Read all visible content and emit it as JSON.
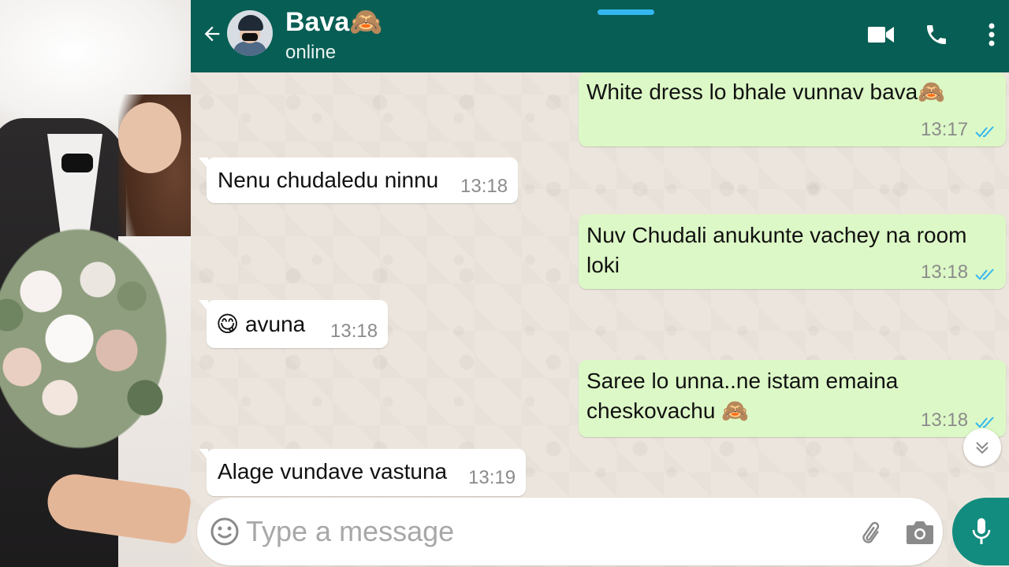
{
  "contact": {
    "name": "Bava🙈",
    "status": "online"
  },
  "messages": [
    {
      "direction": "out",
      "text": "White dress lo bhale vunnav bava🙈",
      "time": "13:17",
      "read": true
    },
    {
      "direction": "in",
      "text": "Nenu chudaledu ninnu",
      "time": "13:18"
    },
    {
      "direction": "out",
      "text": "Nuv Chudali anukunte vachey na room loki",
      "time": "13:18",
      "read": true
    },
    {
      "direction": "in",
      "text": "😋 avuna",
      "time": "13:18"
    },
    {
      "direction": "out",
      "text": "Saree lo unna..ne istam emaina cheskovachu 🙈",
      "time": "13:18",
      "read": true
    },
    {
      "direction": "in",
      "text": "Alage vundave vastuna",
      "time": "13:19"
    }
  ],
  "composer": {
    "placeholder": "Type a message"
  },
  "icons": {
    "back": "arrow-left-icon",
    "video": "video-camera-icon",
    "call": "phone-icon",
    "menu": "more-vertical-icon",
    "emoji": "smiley-icon",
    "attach": "paperclip-icon",
    "camera": "camera-icon",
    "mic": "microphone-icon",
    "scroll": "chevrons-down-icon"
  },
  "colors": {
    "header": "#075e54",
    "outgoing_bubble": "#dcf8c6",
    "incoming_bubble": "#ffffff",
    "read_ticks": "#34b7f1",
    "mic_button": "#128c7e",
    "wallpaper": "#ece5dd"
  }
}
